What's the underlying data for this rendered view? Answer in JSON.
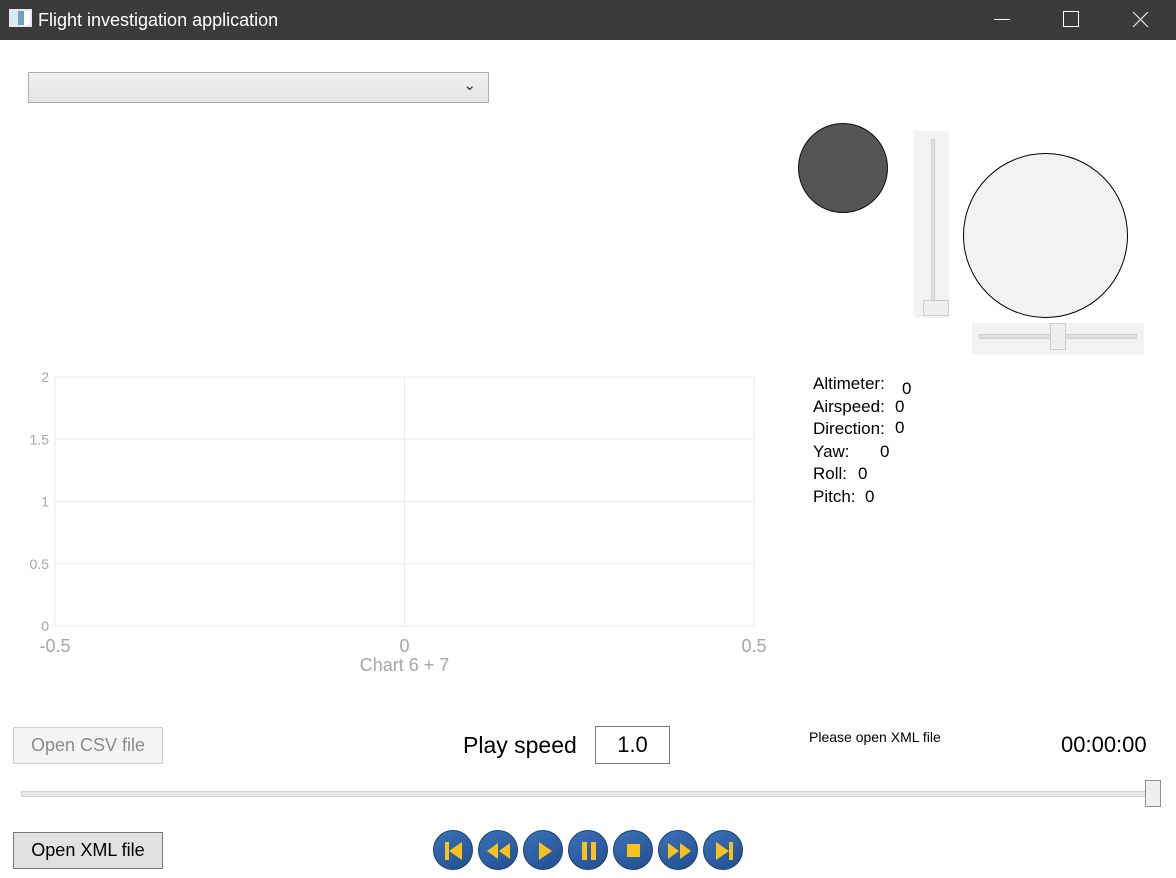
{
  "window": {
    "title": "Flight investigation application"
  },
  "flight_selector": {
    "value": ""
  },
  "flight_values": [
    {
      "label": "Altimeter:",
      "value": "0"
    },
    {
      "label": "Airspeed:",
      "value": "0"
    },
    {
      "label": "Direction:",
      "value": "0"
    },
    {
      "label": "Yaw:",
      "value": "0"
    },
    {
      "label": "Roll:",
      "value": "0"
    },
    {
      "label": "Pitch:",
      "value": "0"
    }
  ],
  "chart_data": {
    "type": "line",
    "title": "",
    "xlabel": "Chart 6 + 7",
    "ylabel": "",
    "xlim": [
      -0.5,
      0.5
    ],
    "ylim": [
      0,
      2
    ],
    "x_ticks": [
      "-0.5",
      "0",
      "0.5"
    ],
    "y_ticks": [
      "0",
      "0.5",
      "1",
      "1.5",
      "2"
    ],
    "grid": true,
    "series": []
  },
  "controls": {
    "open_csv_label": "Open CSV file",
    "open_xml_label": "Open XML file",
    "play_speed_label": "Play speed",
    "play_speed_value": "1.0",
    "status_message": "Please open XML file",
    "time_display": "00:00:00",
    "timeline_position": 1.0
  },
  "media_buttons": [
    {
      "name": "skip-to-start",
      "icon": "skip-start-icon"
    },
    {
      "name": "rewind",
      "icon": "rewind-icon"
    },
    {
      "name": "play",
      "icon": "play-icon"
    },
    {
      "name": "pause",
      "icon": "pause-icon"
    },
    {
      "name": "stop",
      "icon": "stop-icon"
    },
    {
      "name": "fast-forward",
      "icon": "fast-forward-icon"
    },
    {
      "name": "skip-to-end",
      "icon": "skip-end-icon"
    }
  ],
  "colors": {
    "titlebar": "#3b3b3b",
    "media_button": "#2d5ea3",
    "media_icon": "#f7c21e",
    "chart_axis_text": "#a6a6a6",
    "chart_grid": "#ebebeb"
  }
}
